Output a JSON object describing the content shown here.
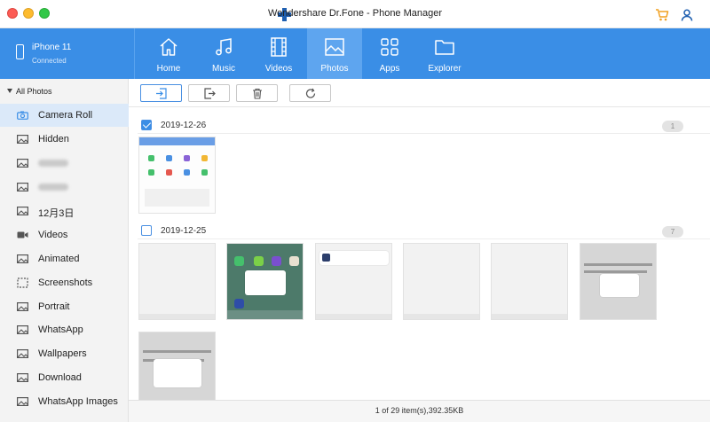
{
  "window": {
    "title": "Wondershare Dr.Fone - Phone Manager"
  },
  "device": {
    "name": "iPhone 11",
    "status": "Connected"
  },
  "tabs": [
    {
      "label": "Home",
      "icon": "home-icon",
      "active": false
    },
    {
      "label": "Music",
      "icon": "music-icon",
      "active": false
    },
    {
      "label": "Videos",
      "icon": "film-icon",
      "active": false
    },
    {
      "label": "Photos",
      "icon": "photo-icon",
      "active": true
    },
    {
      "label": "Apps",
      "icon": "apps-grid-icon",
      "active": false
    },
    {
      "label": "Explorer",
      "icon": "folder-icon",
      "active": false
    }
  ],
  "sidebar": {
    "header": "All Photos",
    "items": [
      {
        "label": "Camera Roll",
        "icon": "camera-icon",
        "active": true
      },
      {
        "label": "Hidden",
        "icon": "image-icon"
      },
      {
        "label": "",
        "icon": "image-icon",
        "blurred": true
      },
      {
        "label": "",
        "icon": "image-icon",
        "blurred": true
      },
      {
        "label": "12月3日",
        "icon": "image-icon"
      },
      {
        "label": "Videos",
        "icon": "video-camera-icon"
      },
      {
        "label": "Animated",
        "icon": "image-icon"
      },
      {
        "label": "Screenshots",
        "icon": "screenshot-icon"
      },
      {
        "label": "Portrait",
        "icon": "image-icon"
      },
      {
        "label": "WhatsApp",
        "icon": "image-icon"
      },
      {
        "label": "Wallpapers",
        "icon": "image-icon"
      },
      {
        "label": "Download",
        "icon": "image-icon"
      },
      {
        "label": "WhatsApp Images",
        "icon": "image-icon"
      }
    ]
  },
  "toolbar": {
    "buttons": [
      {
        "name": "import-button",
        "icon": "import-icon"
      },
      {
        "name": "export-button",
        "icon": "export-icon"
      },
      {
        "name": "delete-button",
        "icon": "trash-icon"
      },
      {
        "name": "refresh-button",
        "icon": "refresh-icon"
      }
    ]
  },
  "groups": [
    {
      "date": "2019-12-26",
      "count": "1",
      "checked": true
    },
    {
      "date": "2019-12-25",
      "count": "7",
      "checked": false
    }
  ],
  "status": {
    "text": "1 of 29 item(s),392.35KB"
  },
  "colors": {
    "accent": "#3a8ee6",
    "nav_active": "#5ea5ef",
    "sidebar_active": "#dbe9f9"
  }
}
